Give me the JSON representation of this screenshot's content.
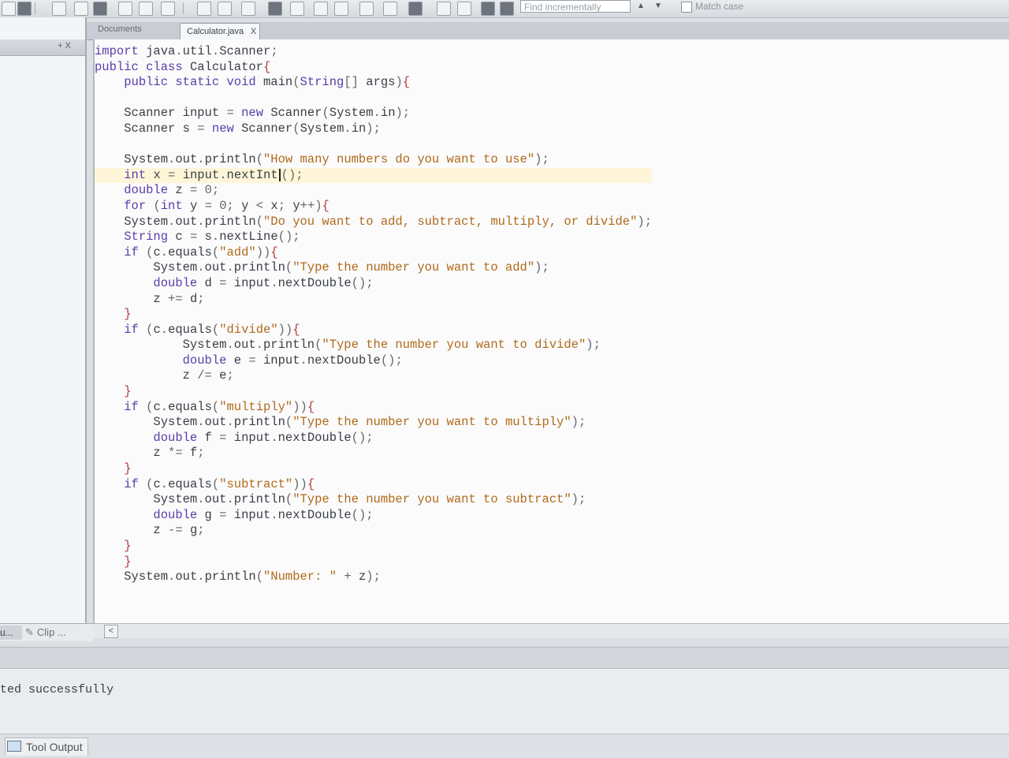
{
  "toolbar": {
    "find_placeholder": "Find incrementally",
    "match_case_label": "Match case"
  },
  "left_pane": {
    "controls": "+ X"
  },
  "editor": {
    "tab_documents": "Documents",
    "tab_file": "Calculator.java",
    "tab_close": "X",
    "code_lines": [
      "import java.util.Scanner;",
      "public class Calculator{",
      "    public static void main(String[] args){",
      "",
      "    Scanner input = new Scanner(System.in);",
      "    Scanner s = new Scanner(System.in);",
      "",
      "    System.out.println(\"How many numbers do you want to use\");",
      "    int x = input.nextInt();",
      "    double z = 0;",
      "    for (int y = 0; y < x; y++){",
      "    System.out.println(\"Do you want to add, subtract, multiply, or divide\");",
      "    String c = s.nextLine();",
      "    if (c.equals(\"add\")){",
      "        System.out.println(\"Type the number you want to add\");",
      "        double d = input.nextDouble();",
      "        z += d;",
      "    }",
      "    if (c.equals(\"divide\")){",
      "            System.out.println(\"Type the number you want to divide\");",
      "            double e = input.nextDouble();",
      "            z /= e;",
      "    }",
      "    if (c.equals(\"multiply\")){",
      "        System.out.println(\"Type the number you want to multiply\");",
      "        double f = input.nextDouble();",
      "        z *= f;",
      "    }",
      "    if (c.equals(\"subtract\")){",
      "        System.out.println(\"Type the number you want to subtract\");",
      "        double g = input.nextDouble();",
      "        z -= g;",
      "    }",
      "    }",
      "    System.out.println(\"Number: \" + z);"
    ],
    "current_line_index": 8
  },
  "bottom_tabs": {
    "cu_label": "u...",
    "clip_label": "Clip ..."
  },
  "output": {
    "text": "ted successfully"
  },
  "status_bar": {
    "tool_output_label": "Tool Output"
  },
  "colors": {
    "keyword": "#5a3ea8",
    "string": "#b06a1a",
    "current_line": "#fff6d8"
  }
}
